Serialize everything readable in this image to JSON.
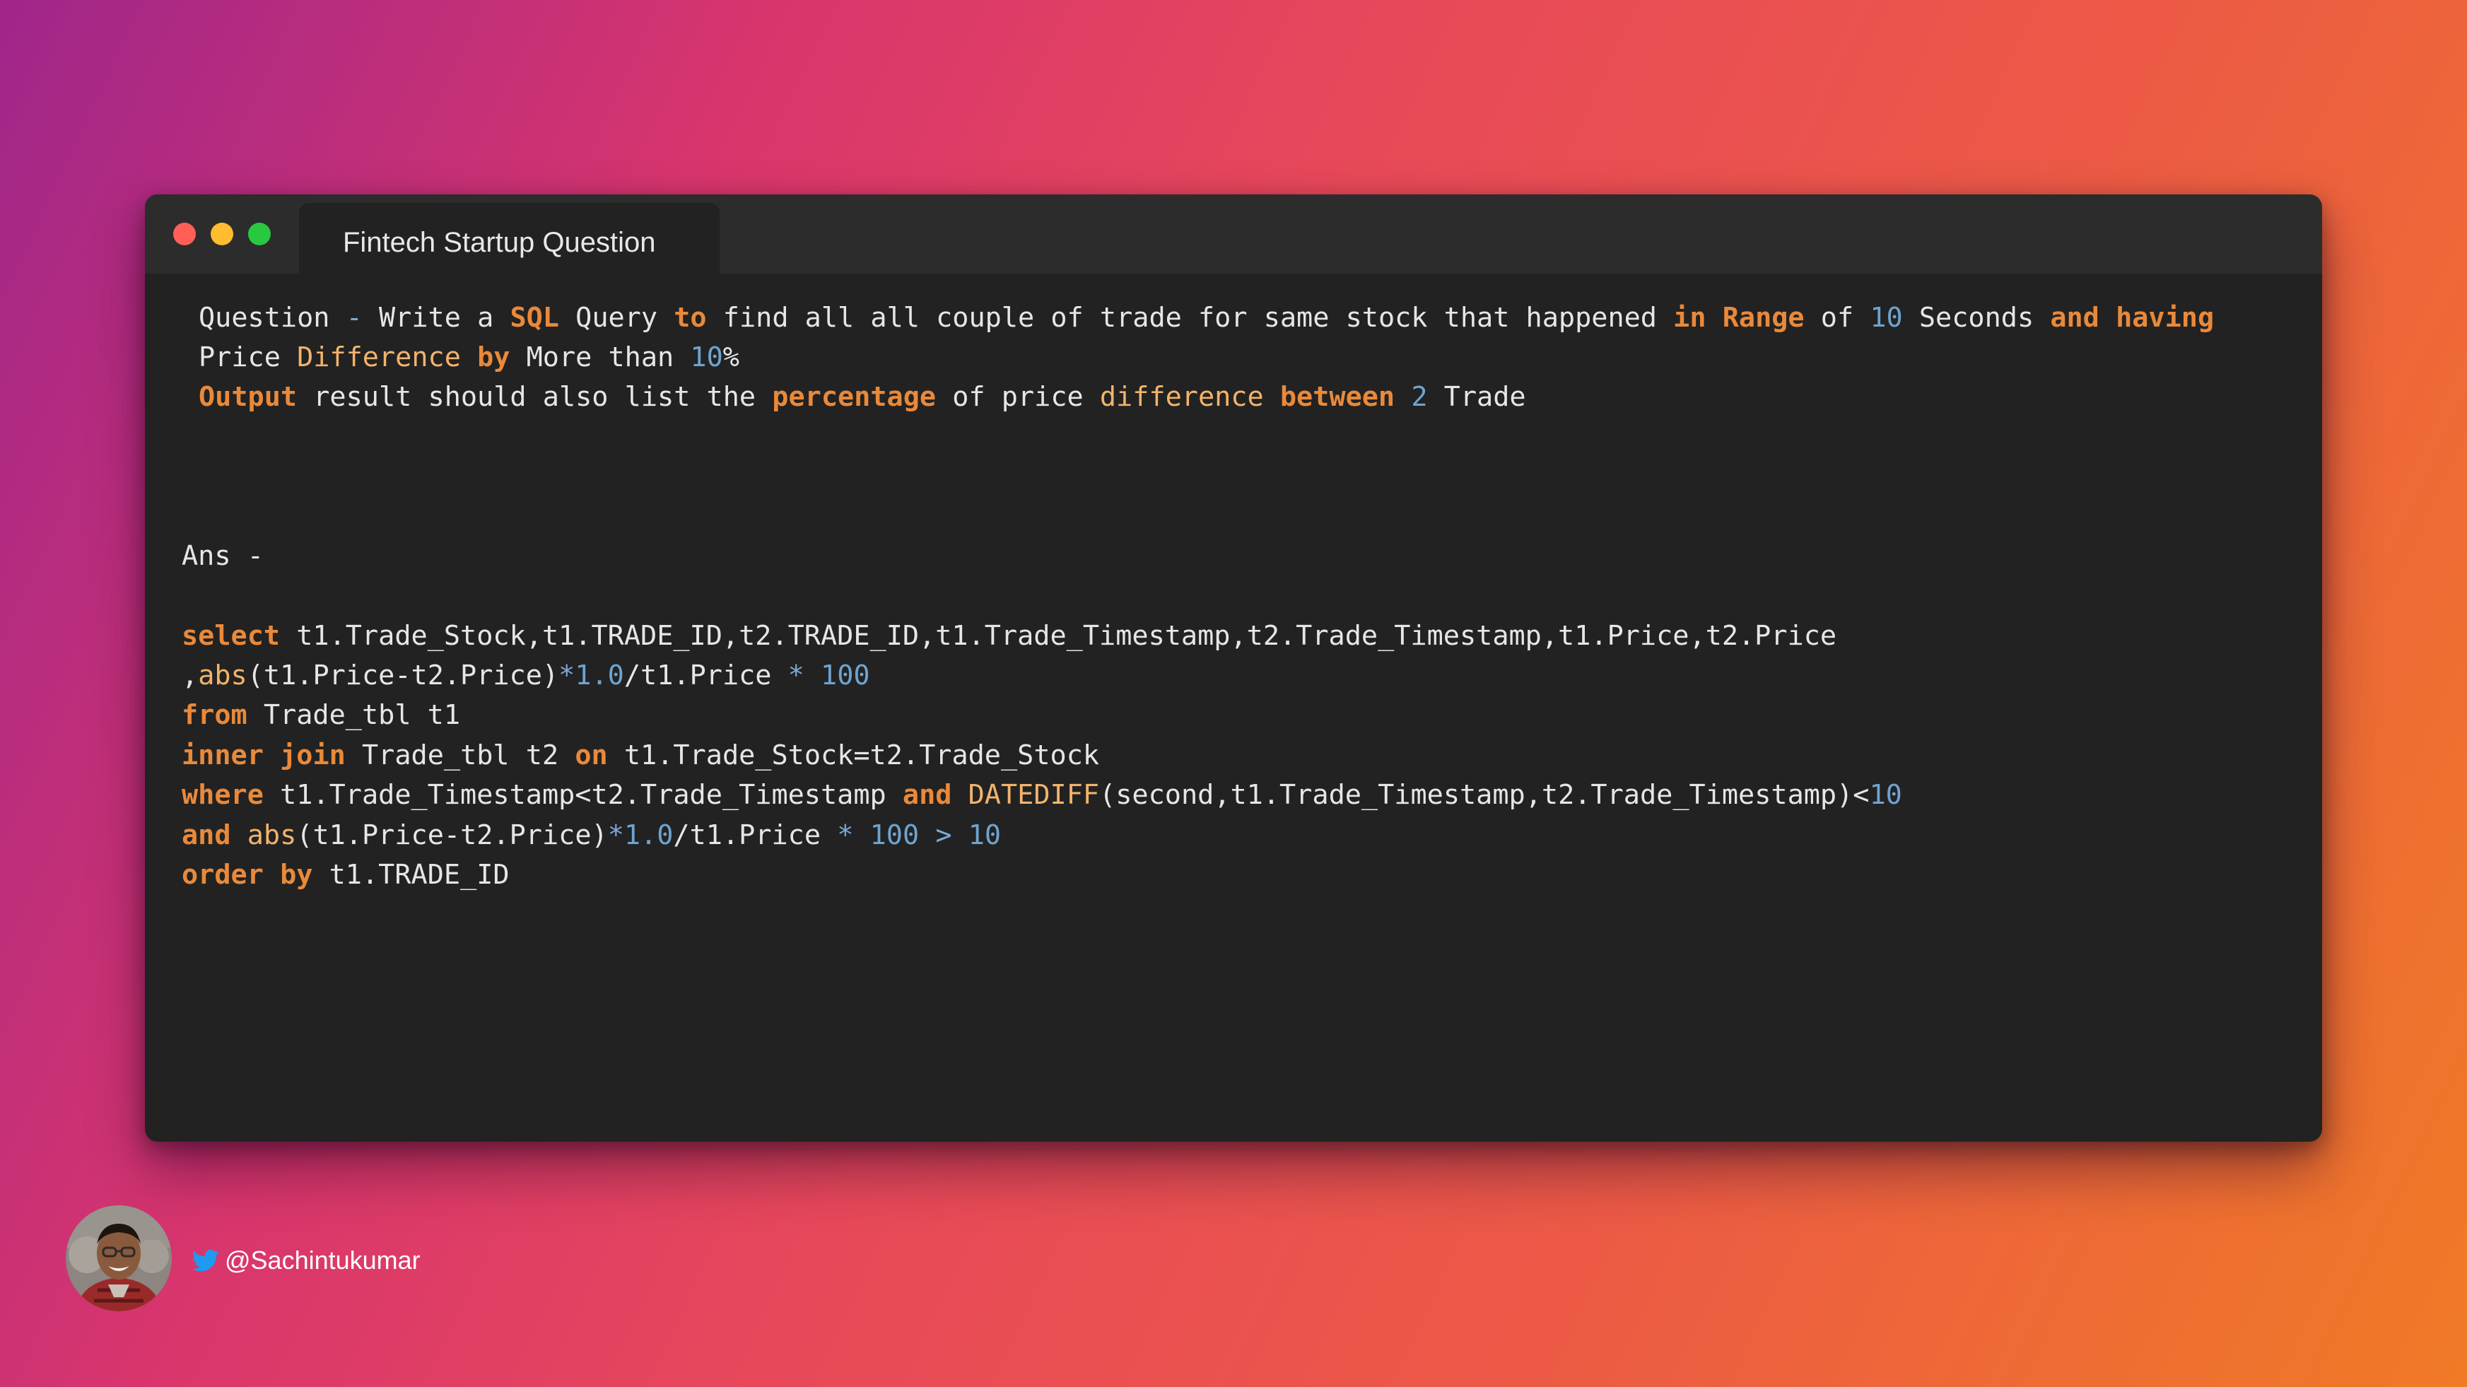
{
  "window": {
    "tab_title": "Fintech Startup Question",
    "traffic_lights": {
      "close": "#ff5f57",
      "minimize": "#febc2e",
      "maximize": "#28c840"
    }
  },
  "code": {
    "question": {
      "line1": {
        "t1": "Question ",
        "t2": "-",
        "t3": " Write a ",
        "t4": "SQL",
        "t5": " Query ",
        "t6": "to",
        "t7": " find all all couple of trade for same stock that happened ",
        "t8": "in",
        "t9": " ",
        "t10": "Range",
        "t11": " of ",
        "t12": "10",
        "t13": " Seconds ",
        "t14": "and",
        "t15": " ",
        "t16": "having"
      },
      "line2": {
        "t1": "Price ",
        "t2": "Difference",
        "t3": " ",
        "t4": "by",
        "t5": " More than ",
        "t6": "10",
        "t7": "%"
      },
      "line3": {
        "t1": "Output",
        "t2": " result should also list the ",
        "t3": "percentage",
        "t4": " of price ",
        "t5": "difference",
        "t6": " ",
        "t7": "between",
        "t8": " ",
        "t9": "2",
        "t10": " Trade"
      }
    },
    "ans_label": "Ans -",
    "sql": {
      "l1": {
        "kw": "select",
        "rest": " t1.Trade_Stock,t1.TRADE_ID,t2.TRADE_ID,t1.Trade_Timestamp,t2.Trade_Timestamp,t1.Price,t2.Price"
      },
      "l2": {
        "t1": ",",
        "t2": "abs",
        "t3": "(t1.Price-t2.Price)",
        "t4": "*",
        "t5": "1.0",
        "t6": "/t1.Price ",
        "t7": "*",
        "t8": " ",
        "t9": "100"
      },
      "l3": {
        "kw": "from",
        "rest": " Trade_tbl t1"
      },
      "l4": {
        "kw1": "inner",
        "s1": " ",
        "kw2": "join",
        "t1": " Trade_tbl t2 ",
        "kw3": "on",
        "t2": " t1.Trade_Stock=t2.Trade_Stock"
      },
      "l5": {
        "kw1": "where",
        "t1": " t1.Trade_Timestamp<t2.Trade_Timestamp ",
        "kw2": "and",
        "s1": " ",
        "fn": "DATEDIFF",
        "t2": "(second,t1.Trade_Timestamp,t2.Trade_Timestamp)<",
        "n1": "10"
      },
      "l6": {
        "kw1": "and",
        "s1": " ",
        "fn": "abs",
        "t1": "(t1.Price-t2.Price)",
        "op1": "*",
        "n1": "1.0",
        "t2": "/t1.Price ",
        "op2": "*",
        "s2": " ",
        "n2": "100",
        "s3": " ",
        "op3": ">",
        "s4": " ",
        "n3": "10"
      },
      "l7": {
        "kw1": "order",
        "s1": " ",
        "kw2": "by",
        "rest": " t1.TRADE_ID"
      }
    }
  },
  "footer": {
    "twitter_icon": "twitter-bird-icon",
    "twitter_color": "#1d9bf0",
    "handle": "@Sachintukumar"
  }
}
